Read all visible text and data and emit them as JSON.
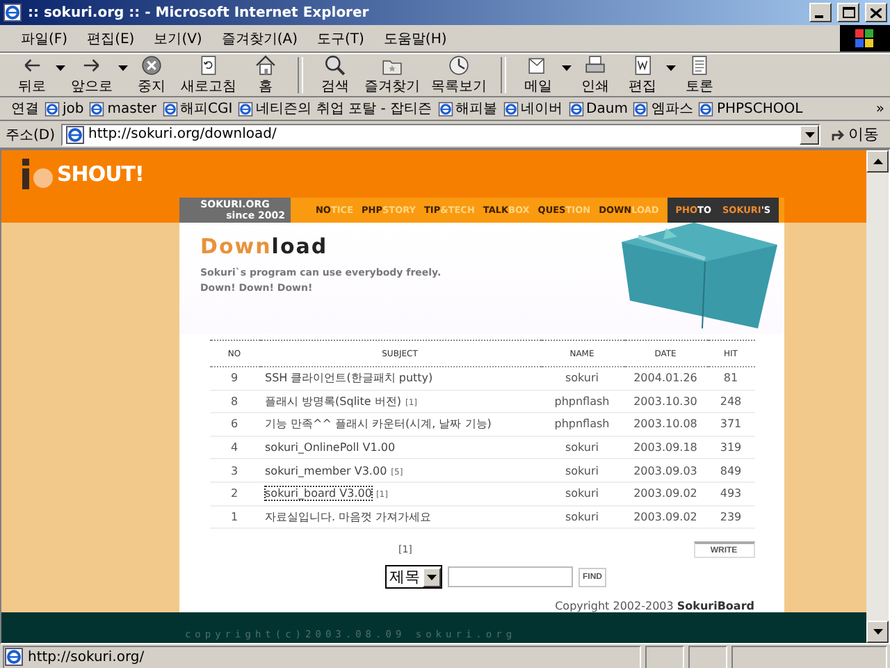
{
  "window": {
    "title": ":: sokuri.org :: - Microsoft Internet Explorer"
  },
  "menu": [
    "파일(F)",
    "편집(E)",
    "보기(V)",
    "즐겨찾기(A)",
    "도구(T)",
    "도움말(H)"
  ],
  "toolbar": [
    [
      {
        "label": "뒤로",
        "dropdown": true
      },
      {
        "label": "앞으로",
        "dropdown": true
      },
      {
        "label": "중지",
        "dropdown": false
      },
      {
        "label": "새로고침",
        "dropdown": false
      },
      {
        "label": "홈",
        "dropdown": false
      }
    ],
    [
      {
        "label": "검색",
        "dropdown": false
      },
      {
        "label": "즐겨찾기",
        "dropdown": false
      },
      {
        "label": "목록보기",
        "dropdown": false
      }
    ],
    [
      {
        "label": "메일",
        "dropdown": true
      },
      {
        "label": "인쇄",
        "dropdown": false
      },
      {
        "label": "편집",
        "dropdown": true
      },
      {
        "label": "토론",
        "dropdown": false
      }
    ]
  ],
  "links": {
    "label": "연결",
    "items": [
      "job",
      "master",
      "해피CGI",
      "네티즌의 취업 포탈 - 잡티즌",
      "해피볼",
      "네이버",
      "Daum",
      "엠파스",
      "PHPSCHOOL"
    ],
    "overflow": "»"
  },
  "address": {
    "label": "주소(D)",
    "value": "http://sokuri.org/download/",
    "go": "이동"
  },
  "page": {
    "logo": "SHOUT!",
    "badge": [
      "SOKURI.ORG",
      "since 2002"
    ],
    "nav": [
      {
        "kind": "main",
        "part1": "NO",
        "part2": "TICE"
      },
      {
        "kind": "main",
        "part1": "PHP",
        "part2": "STORY"
      },
      {
        "kind": "main",
        "part1": "TIP",
        "part2": "&TECH"
      },
      {
        "kind": "main",
        "part1": "TALK",
        "part2": "BOX"
      },
      {
        "kind": "main",
        "part1": "QUES",
        "part2": "TION"
      },
      {
        "kind": "main",
        "part1": "DOWN",
        "part2": "LOAD"
      },
      {
        "kind": "extra",
        "part1": "PHO",
        "part2": "TO"
      },
      {
        "kind": "extra",
        "part1": "SOKURI",
        "part2": "'S"
      }
    ],
    "heading": {
      "accent": "Down",
      "rest": "load"
    },
    "intro": [
      "Sokuri`s program can use everybody freely.",
      "Down! Down! Down!"
    ],
    "table": {
      "columns": [
        "NO",
        "SUBJECT",
        "NAME",
        "DATE",
        "HIT"
      ],
      "rows": [
        {
          "no": "9",
          "subject": {
            "title": "SSH 클라이언트(한글패치 putty)"
          },
          "name": "sokuri",
          "date": "2004.01.26",
          "hit": "81",
          "focused": false
        },
        {
          "no": "8",
          "subject": {
            "title": "플래시 방명록(Sqlite 버전)",
            "comments": "[1]"
          },
          "name": "phpnflash",
          "date": "2003.10.30",
          "hit": "248",
          "focused": false
        },
        {
          "no": "6",
          "subject": {
            "title": "기능 만족^^ 플래시 카운터(시계, 날짜 기능)"
          },
          "name": "phpnflash",
          "date": "2003.10.08",
          "hit": "371",
          "focused": false
        },
        {
          "no": "4",
          "subject": {
            "title": "sokuri_OnlinePoll V1.00"
          },
          "name": "sokuri",
          "date": "2003.09.18",
          "hit": "319",
          "focused": false
        },
        {
          "no": "3",
          "subject": {
            "title": "sokuri_member V3.00",
            "comments": "[5]"
          },
          "name": "sokuri",
          "date": "2003.09.03",
          "hit": "849",
          "focused": false
        },
        {
          "no": "2",
          "subject": {
            "title": "sokuri_board V3.00",
            "comments": "[1]"
          },
          "name": "sokuri",
          "date": "2003.09.02",
          "hit": "493",
          "focused": true
        },
        {
          "no": "1",
          "subject": {
            "title": "자료실입니다. 마음껏 가져가세요"
          },
          "name": "sokuri",
          "date": "2003.09.02",
          "hit": "239",
          "focused": false
        }
      ]
    },
    "pager": "[1]",
    "write": "WRITE",
    "search": {
      "field": "제목",
      "button": "FIND"
    },
    "copyright": "Copyright 2002-2003 **SokuriBoard**",
    "footer": "copyright(c)2003.08.09 sokuri.org"
  },
  "status": {
    "text": "http://sokuri.org/"
  }
}
